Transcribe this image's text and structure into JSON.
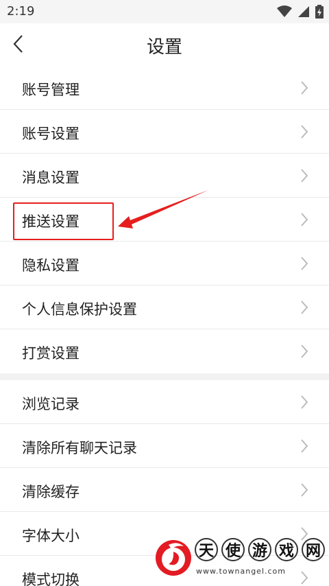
{
  "status_bar": {
    "time": "2:19"
  },
  "header": {
    "title": "设置"
  },
  "list_group_1": [
    {
      "label": "账号管理"
    },
    {
      "label": "账号设置"
    },
    {
      "label": "消息设置"
    },
    {
      "label": "推送设置"
    },
    {
      "label": "隐私设置"
    },
    {
      "label": "个人信息保护设置"
    },
    {
      "label": "打赏设置"
    }
  ],
  "list_group_2": [
    {
      "label": "浏览记录"
    },
    {
      "label": "清除所有聊天记录"
    },
    {
      "label": "清除缓存"
    },
    {
      "label": "字体大小"
    },
    {
      "label": "模式切换"
    }
  ],
  "watermark": {
    "chars": [
      "天",
      "使",
      "游",
      "戏",
      "网"
    ],
    "url": "www.townangel.com"
  },
  "colors": {
    "annotation": "#e61e1e",
    "divider": "#e9e9e9",
    "section_gap": "#f2f2f2"
  },
  "icons": {
    "back": "chevron-left-icon",
    "row": "chevron-right-icon",
    "wifi": "wifi-icon",
    "signal": "signal-icon",
    "battery": "battery-charging-icon"
  }
}
